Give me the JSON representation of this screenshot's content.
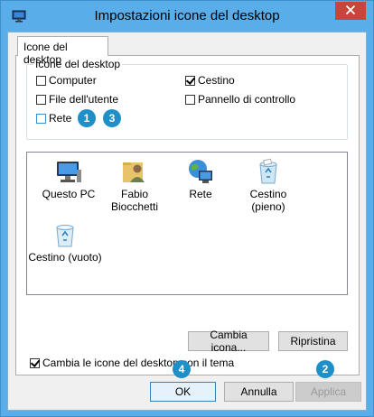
{
  "window": {
    "title": "Impostazioni icone del desktop",
    "accent_color": "#59aee9",
    "close_color": "#c7453a"
  },
  "tab": {
    "label": "Icone del desktop"
  },
  "group": {
    "legend": "Icone del desktop",
    "checkboxes": [
      {
        "label": "Computer",
        "checked": false
      },
      {
        "label": "Cestino",
        "checked": true
      },
      {
        "label": "File dell'utente",
        "checked": false
      },
      {
        "label": "Pannello di controllo",
        "checked": false
      },
      {
        "label": "Rete",
        "checked": false
      }
    ]
  },
  "badges": [
    "1",
    "3",
    "4",
    "2"
  ],
  "icons": [
    {
      "label": "Questo PC",
      "icon": "computer-icon"
    },
    {
      "label": "Fabio Biocchetti",
      "icon": "user-folder-icon"
    },
    {
      "label": "Rete",
      "icon": "network-globe-icon"
    },
    {
      "label": "Cestino (pieno)",
      "icon": "recycle-bin-full-icon"
    },
    {
      "label": "Cestino (vuoto)",
      "icon": "recycle-bin-empty-icon"
    }
  ],
  "buttons": {
    "change_icon": "Cambia icona...",
    "restore": "Ripristina",
    "ok": "OK",
    "cancel": "Annulla",
    "apply": "Applica"
  },
  "theme_checkbox": {
    "label": "Cambia le icone del desktop con il tema",
    "checked": true
  }
}
